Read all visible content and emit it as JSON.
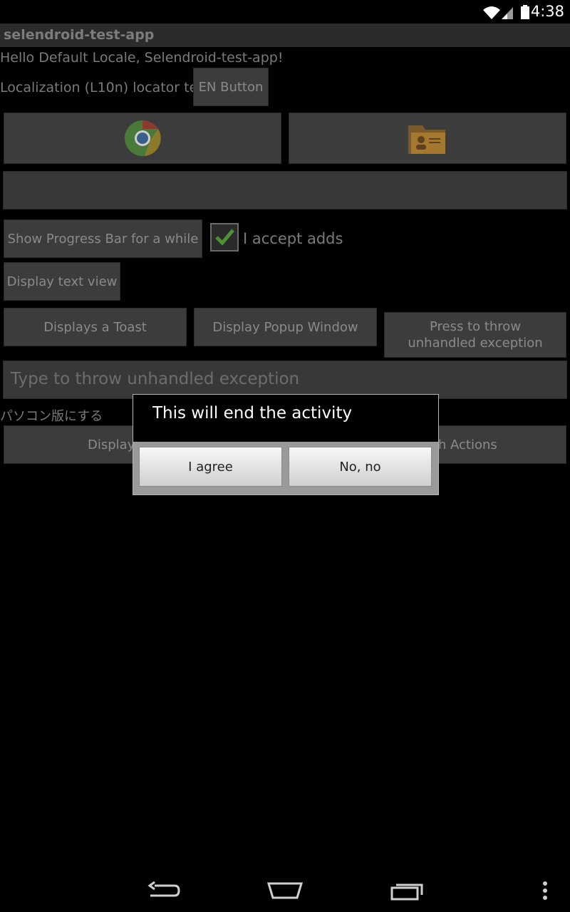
{
  "status_bar": {
    "time": "4:38",
    "icons": [
      "wifi-icon",
      "signal-icon",
      "battery-icon"
    ]
  },
  "app": {
    "title": "selendroid-test-app",
    "hello_text": "Hello Default Locale, Selendroid-test-app!",
    "l10n_label": "Localization (L10n) locator test",
    "en_button": "EN Button",
    "image_buttons": [
      "chrome-icon",
      "contacts-folder-icon"
    ],
    "progress_button": "Show Progress Bar for a while",
    "accept_adds_label": "I accept adds",
    "accept_adds_checked": true,
    "display_text_view_button": "Display text view",
    "toast_button": "Displays a Toast",
    "popup_button": "Display Popup Window",
    "throw_exception_button": "Press to throw unhandled exception",
    "exception_input_placeholder": "Type to throw unhandled exception",
    "japanese_text": "パソコン版にする",
    "display_button_partial": "Display",
    "touch_actions_partial": "ch Actions"
  },
  "dialog": {
    "title": "This will end the activity",
    "agree_button": "I agree",
    "no_button": "No, no"
  },
  "nav_bar": {
    "icons": [
      "back-icon",
      "home-icon",
      "recent-apps-icon",
      "overflow-menu-icon"
    ]
  }
}
